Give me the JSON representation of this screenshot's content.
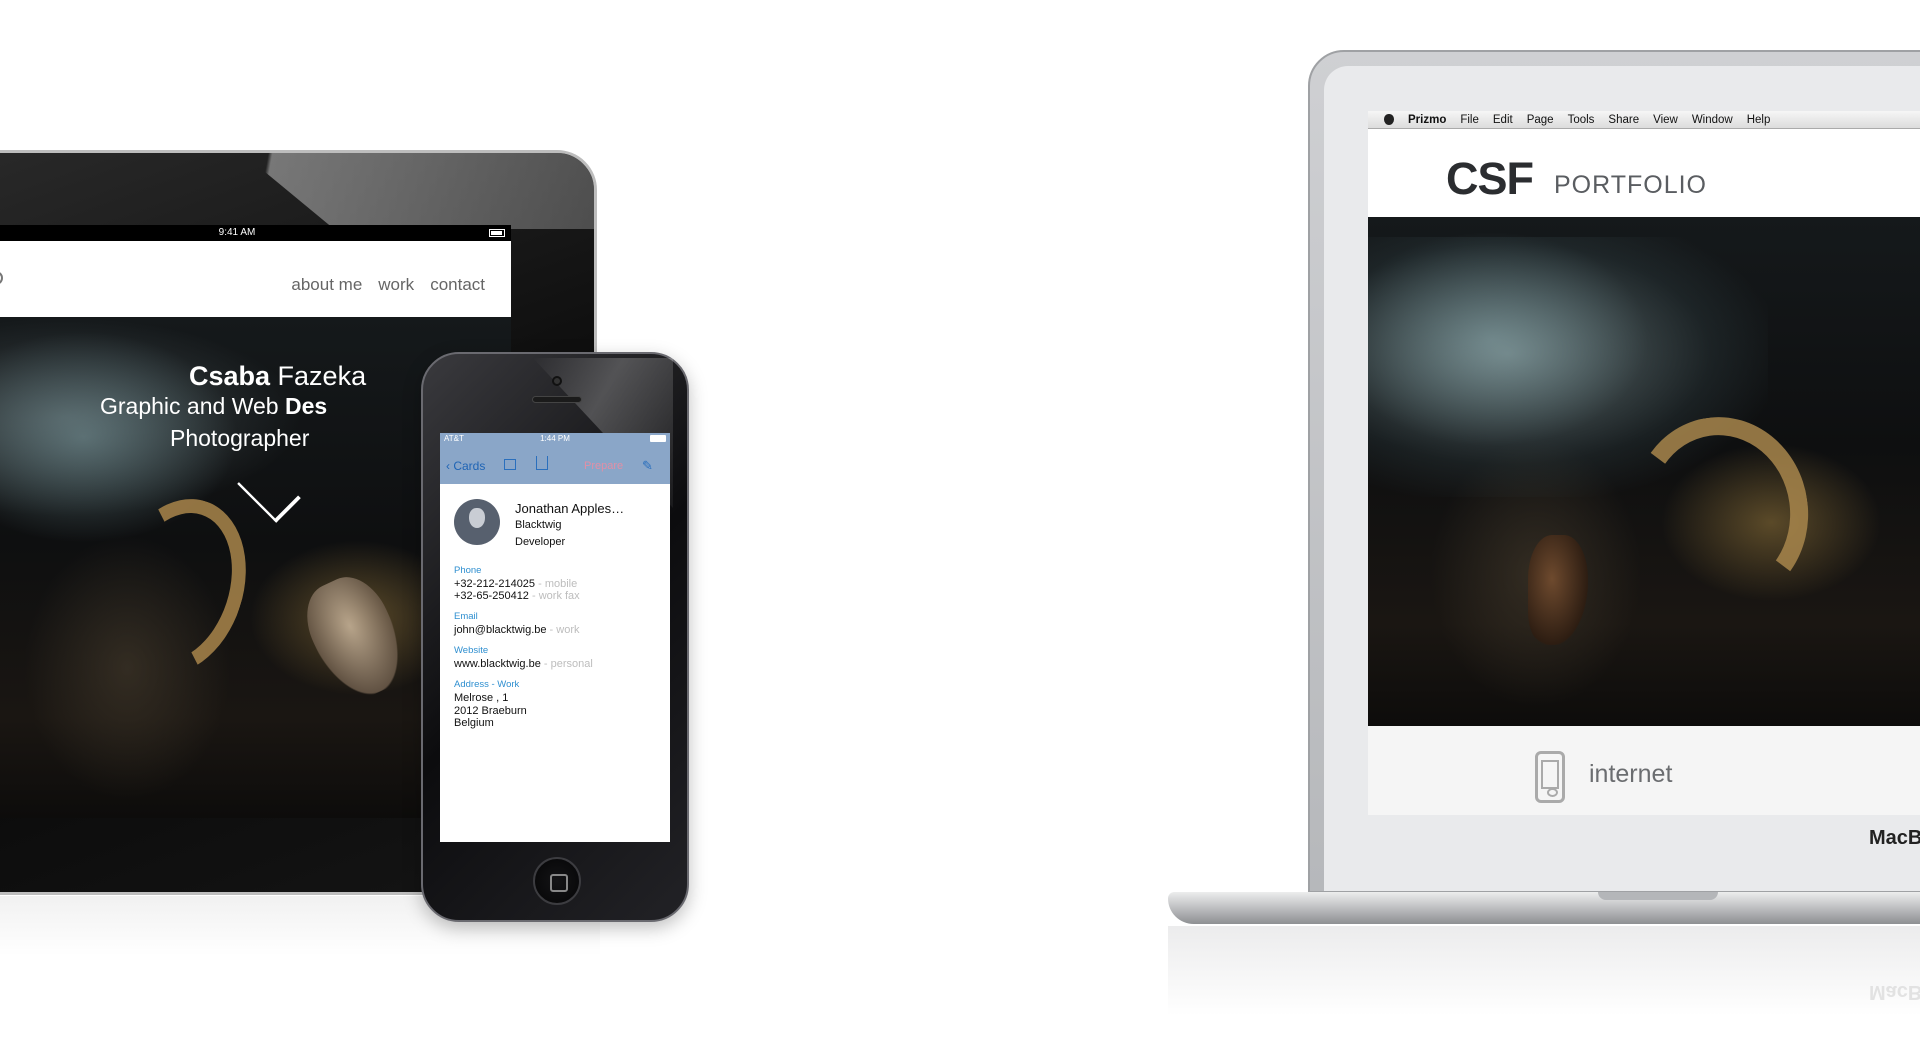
{
  "ipad": {
    "status_time": "9:41 AM",
    "nav_links": [
      "about me",
      "work",
      "contact"
    ],
    "hero": {
      "line1_bold": "Csaba",
      "line1_rest": " Fazeka",
      "line2_start": "Graphic and Web ",
      "line2_bold": "Des",
      "line3": "Photographer"
    }
  },
  "iphone": {
    "status": {
      "carrier": "AT&T",
      "time": "1:44 PM"
    },
    "toolbar": {
      "back_label": "Cards",
      "prepare_label": "Prepare"
    },
    "contact": {
      "name": "Jonathan Apples…",
      "company": "Blacktwig",
      "title": "Developer",
      "phone_label": "Phone",
      "phones": [
        {
          "number": "+32-212-214025",
          "tag": " - mobile"
        },
        {
          "number": "+32-65-250412",
          "tag": " - work fax"
        }
      ],
      "email_label": "Email",
      "email": {
        "value": "john@blacktwig.be",
        "tag": " - work"
      },
      "website_label": "Website",
      "website": {
        "value": "www.blacktwig.be",
        "tag": " - personal"
      },
      "address_label": "Address - Work",
      "address_lines": [
        "Melrose , 1",
        "2012 Braeburn",
        "Belgium"
      ]
    }
  },
  "macbook": {
    "menubar": {
      "app_name": "Prizmo",
      "items": [
        "File",
        "Edit",
        "Page",
        "Tools",
        "Share",
        "View",
        "Window",
        "Help"
      ]
    },
    "logo_bold": "CSF",
    "logo_light": "PORTFOLIO",
    "footer_label": "internet",
    "brand": "MacB",
    "reflection_brand": "MacB"
  },
  "colors": {
    "ios_blue": "#2f8fd0",
    "ios_bar": "#8aa6c8",
    "prepare_pink": "#e28fa6",
    "logo_dark": "#2b2d30"
  }
}
